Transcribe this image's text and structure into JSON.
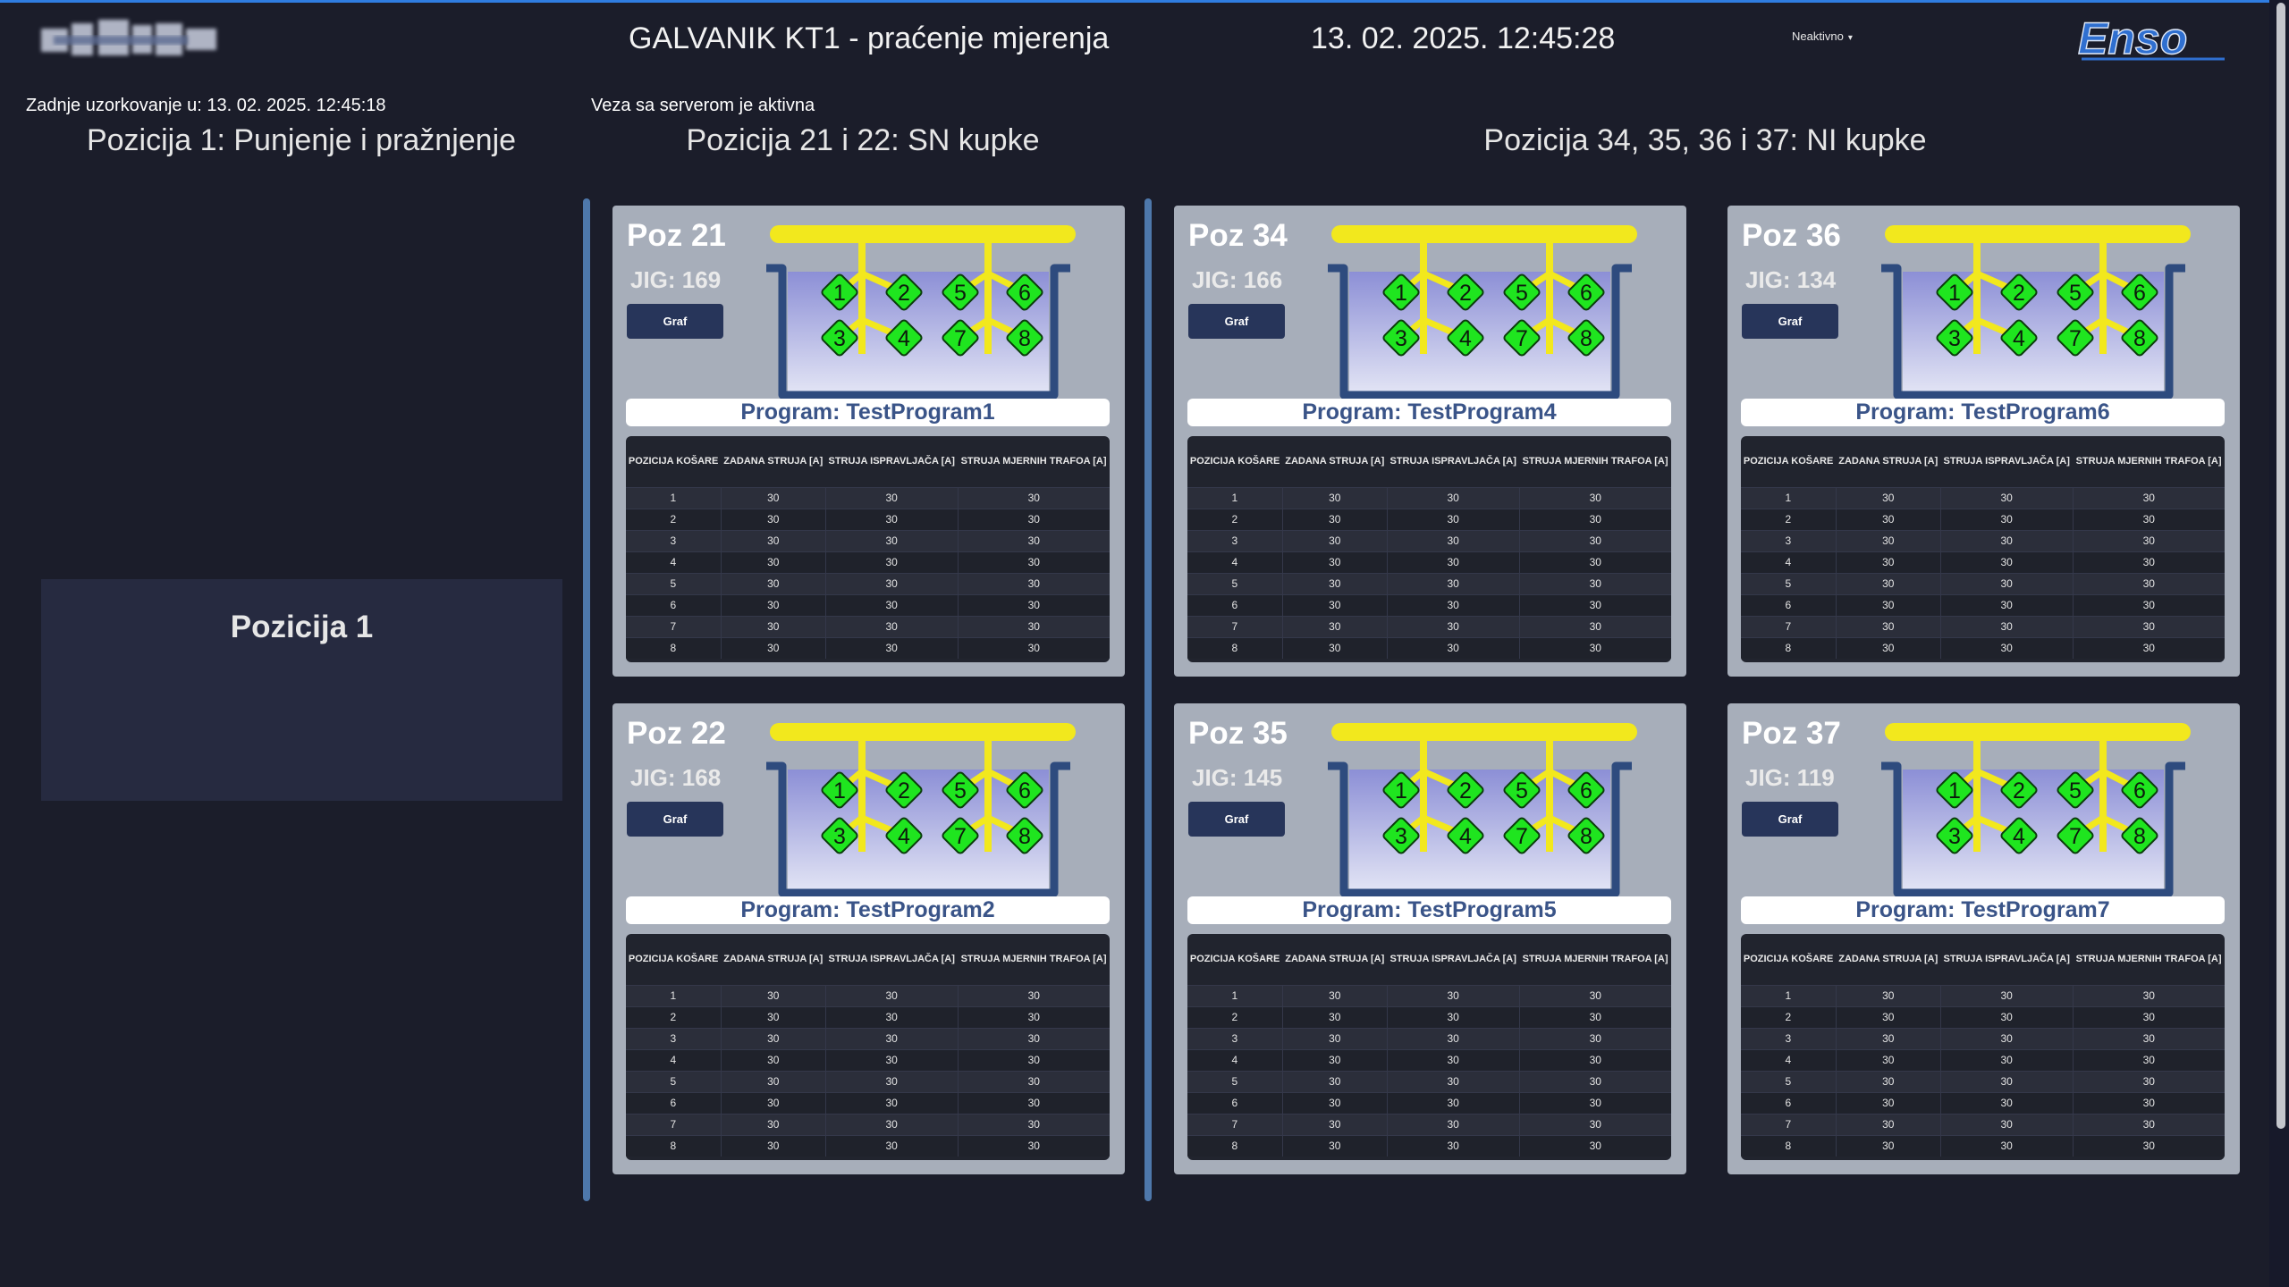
{
  "header": {
    "title": "GALVANIK KT1 - praćenje mjerenja",
    "datetime": "13. 02. 2025. 12:45:28",
    "user_status": "Neaktivno",
    "brand_logo_text": "Enso"
  },
  "status": {
    "last_sample": "Zadnje uzorkovanje u: 13. 02. 2025. 12:45:18",
    "server": "Veza sa serverom je aktivna"
  },
  "sections": {
    "pos1_title": "Pozicija 1: Punjenje i pražnjenje",
    "sn_title": "Pozicija 21 i 22: SN kupke",
    "ni_title": "Pozicija 34, 35, 36 i 37: NI kupke",
    "pos1_box_label": "Pozicija 1"
  },
  "colors": {
    "background": "#1b1d2a",
    "card": "#a7aeba",
    "tank_outline": "#2e4b7e",
    "busbar": "#f2e81d",
    "basket": "#1fe51f",
    "button": "#27355a",
    "program_text": "#3a5488"
  },
  "table_headers": [
    "POZICIJA KOŠARE",
    "ZADANA STRUJA [A]",
    "STRUJA ISPRAVLJAČA [A]",
    "STRUJA MJERNIH TRAFOA [A]"
  ],
  "graf_label": "Graf",
  "basket_labels": [
    "1",
    "2",
    "5",
    "6",
    "3",
    "4",
    "7",
    "8"
  ],
  "cards": [
    {
      "poz": "Poz 21",
      "jig": "JIG: 169",
      "program": "Program: TestProgram1",
      "rows": [
        [
          "1",
          "30",
          "30",
          "30"
        ],
        [
          "2",
          "30",
          "30",
          "30"
        ],
        [
          "3",
          "30",
          "30",
          "30"
        ],
        [
          "4",
          "30",
          "30",
          "30"
        ],
        [
          "5",
          "30",
          "30",
          "30"
        ],
        [
          "6",
          "30",
          "30",
          "30"
        ],
        [
          "7",
          "30",
          "30",
          "30"
        ],
        [
          "8",
          "30",
          "30",
          "30"
        ]
      ]
    },
    {
      "poz": "Poz 22",
      "jig": "JIG: 168",
      "program": "Program: TestProgram2",
      "rows": [
        [
          "1",
          "30",
          "30",
          "30"
        ],
        [
          "2",
          "30",
          "30",
          "30"
        ],
        [
          "3",
          "30",
          "30",
          "30"
        ],
        [
          "4",
          "30",
          "30",
          "30"
        ],
        [
          "5",
          "30",
          "30",
          "30"
        ],
        [
          "6",
          "30",
          "30",
          "30"
        ],
        [
          "7",
          "30",
          "30",
          "30"
        ],
        [
          "8",
          "30",
          "30",
          "30"
        ]
      ]
    },
    {
      "poz": "Poz 34",
      "jig": "JIG: 166",
      "program": "Program: TestProgram4",
      "rows": [
        [
          "1",
          "30",
          "30",
          "30"
        ],
        [
          "2",
          "30",
          "30",
          "30"
        ],
        [
          "3",
          "30",
          "30",
          "30"
        ],
        [
          "4",
          "30",
          "30",
          "30"
        ],
        [
          "5",
          "30",
          "30",
          "30"
        ],
        [
          "6",
          "30",
          "30",
          "30"
        ],
        [
          "7",
          "30",
          "30",
          "30"
        ],
        [
          "8",
          "30",
          "30",
          "30"
        ]
      ]
    },
    {
      "poz": "Poz 35",
      "jig": "JIG: 145",
      "program": "Program: TestProgram5",
      "rows": [
        [
          "1",
          "30",
          "30",
          "30"
        ],
        [
          "2",
          "30",
          "30",
          "30"
        ],
        [
          "3",
          "30",
          "30",
          "30"
        ],
        [
          "4",
          "30",
          "30",
          "30"
        ],
        [
          "5",
          "30",
          "30",
          "30"
        ],
        [
          "6",
          "30",
          "30",
          "30"
        ],
        [
          "7",
          "30",
          "30",
          "30"
        ],
        [
          "8",
          "30",
          "30",
          "30"
        ]
      ]
    },
    {
      "poz": "Poz 36",
      "jig": "JIG: 134",
      "program": "Program: TestProgram6",
      "rows": [
        [
          "1",
          "30",
          "30",
          "30"
        ],
        [
          "2",
          "30",
          "30",
          "30"
        ],
        [
          "3",
          "30",
          "30",
          "30"
        ],
        [
          "4",
          "30",
          "30",
          "30"
        ],
        [
          "5",
          "30",
          "30",
          "30"
        ],
        [
          "6",
          "30",
          "30",
          "30"
        ],
        [
          "7",
          "30",
          "30",
          "30"
        ],
        [
          "8",
          "30",
          "30",
          "30"
        ]
      ]
    },
    {
      "poz": "Poz 37",
      "jig": "JIG: 119",
      "program": "Program: TestProgram7",
      "rows": [
        [
          "1",
          "30",
          "30",
          "30"
        ],
        [
          "2",
          "30",
          "30",
          "30"
        ],
        [
          "3",
          "30",
          "30",
          "30"
        ],
        [
          "4",
          "30",
          "30",
          "30"
        ],
        [
          "5",
          "30",
          "30",
          "30"
        ],
        [
          "6",
          "30",
          "30",
          "30"
        ],
        [
          "7",
          "30",
          "30",
          "30"
        ],
        [
          "8",
          "30",
          "30",
          "30"
        ]
      ]
    }
  ]
}
